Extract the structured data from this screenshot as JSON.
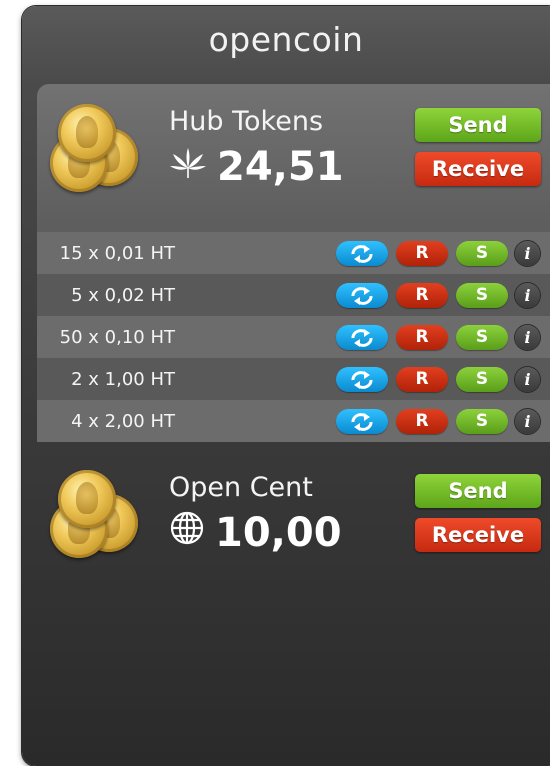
{
  "app": {
    "title": "opencoin"
  },
  "currencies": [
    {
      "name": "Hub Tokens",
      "icon": "cannabis-leaf-icon",
      "amount": "24,51",
      "send_label": "Send",
      "receive_label": "Receive",
      "denominations": [
        {
          "label": "15 x 0,01 HT"
        },
        {
          "label": "5 x 0,02 HT"
        },
        {
          "label": "50 x 0,10 HT"
        },
        {
          "label": "2 x 1,00 HT"
        },
        {
          "label": "4 x 2,00 HT"
        }
      ]
    },
    {
      "name": "Open Cent",
      "icon": "globe-icon",
      "amount": "10,00",
      "send_label": "Send",
      "receive_label": "Receive"
    }
  ],
  "row_actions": {
    "exchange_icon": "exchange-arrows-icon",
    "receive": "R",
    "send": "S",
    "info": "i"
  },
  "colors": {
    "send": "#6fbf24",
    "receive": "#d8341a",
    "exchange": "#1aa6ea",
    "background": "#3c3c3c"
  }
}
